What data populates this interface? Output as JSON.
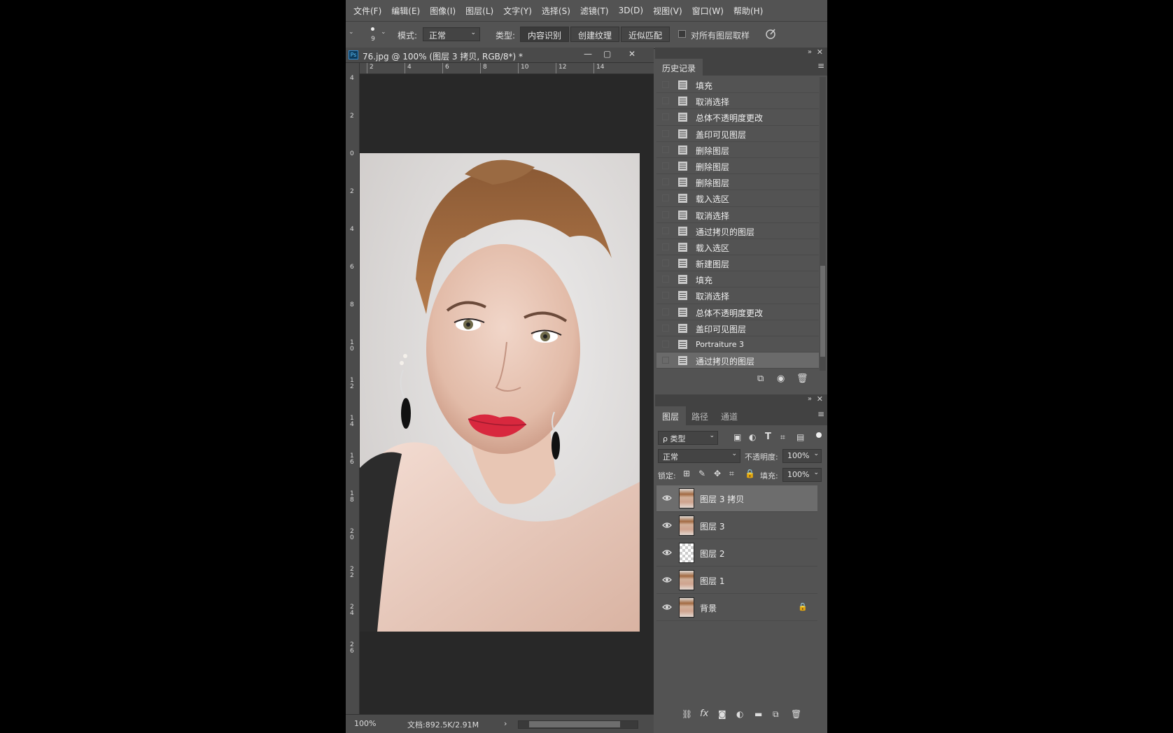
{
  "menu": [
    "文件(F)",
    "编辑(E)",
    "图像(I)",
    "图层(L)",
    "文字(Y)",
    "选择(S)",
    "滤镜(T)",
    "3D(D)",
    "视图(V)",
    "窗口(W)",
    "帮助(H)"
  ],
  "options": {
    "brush_size": "9",
    "mode_label": "模式:",
    "mode_value": "正常",
    "type_label": "类型:",
    "type_buttons": [
      "内容识别",
      "创建纹理",
      "近似匹配"
    ],
    "sample_all_label": "对所有图层取样"
  },
  "document": {
    "title": "76.jpg @ 100% (图层 3 拷贝, RGB/8*) *",
    "ruler_h_ticks": [
      "2",
      "4",
      "6",
      "8",
      "10",
      "12",
      "14"
    ],
    "ruler_v_ticks": [
      "4",
      "2",
      "0",
      "2",
      "4",
      "6",
      "8",
      "1\n0",
      "1\n2",
      "1\n4",
      "1\n6",
      "1\n8",
      "2\n0",
      "2\n2",
      "2\n4",
      "2\n6"
    ],
    "zoom": "100%",
    "doc_info": "文档:892.5K/2.91M"
  },
  "history": {
    "tab_label": "历史记录",
    "items": [
      {
        "label": "填充",
        "small": false
      },
      {
        "label": "取消选择",
        "small": false
      },
      {
        "label": "总体不透明度更改",
        "small": false
      },
      {
        "label": "盖印可见图层",
        "small": false
      },
      {
        "label": "删除图层",
        "small": false
      },
      {
        "label": "删除图层",
        "small": false
      },
      {
        "label": "删除图层",
        "small": false
      },
      {
        "label": "载入选区",
        "small": false
      },
      {
        "label": "取消选择",
        "small": false
      },
      {
        "label": "通过拷贝的图层",
        "small": false
      },
      {
        "label": "载入选区",
        "small": false
      },
      {
        "label": "新建图层",
        "small": false
      },
      {
        "label": "填充",
        "small": false
      },
      {
        "label": "取消选择",
        "small": false
      },
      {
        "label": "总体不透明度更改",
        "small": false
      },
      {
        "label": "盖印可见图层",
        "small": false
      },
      {
        "label": "Portraiture 3",
        "small": true
      },
      {
        "label": "通过拷贝的图层",
        "small": false
      }
    ],
    "active_index": 17
  },
  "layers_panel": {
    "tabs": [
      "图层",
      "路径",
      "通道"
    ],
    "filter_label": "ρ 类型",
    "blend_mode": "正常",
    "opacity_label": "不透明度:",
    "opacity_value": "100%",
    "lock_label": "锁定:",
    "fill_label": "填充:",
    "fill_value": "100%",
    "layers": [
      {
        "name": "图层 3 拷贝",
        "thumb": "face",
        "selected": true,
        "locked": false
      },
      {
        "name": "图层 3",
        "thumb": "face",
        "selected": false,
        "locked": false
      },
      {
        "name": "图层 2",
        "thumb": "transparent",
        "selected": false,
        "locked": false
      },
      {
        "name": "图层 1",
        "thumb": "face",
        "selected": false,
        "locked": false
      },
      {
        "name": "背景",
        "thumb": "face",
        "selected": false,
        "locked": true
      }
    ]
  },
  "colors": {
    "ui_background": "#535353",
    "panel_header": "#424242",
    "canvas_bg": "#282828",
    "selection": "#6d6d6d"
  }
}
